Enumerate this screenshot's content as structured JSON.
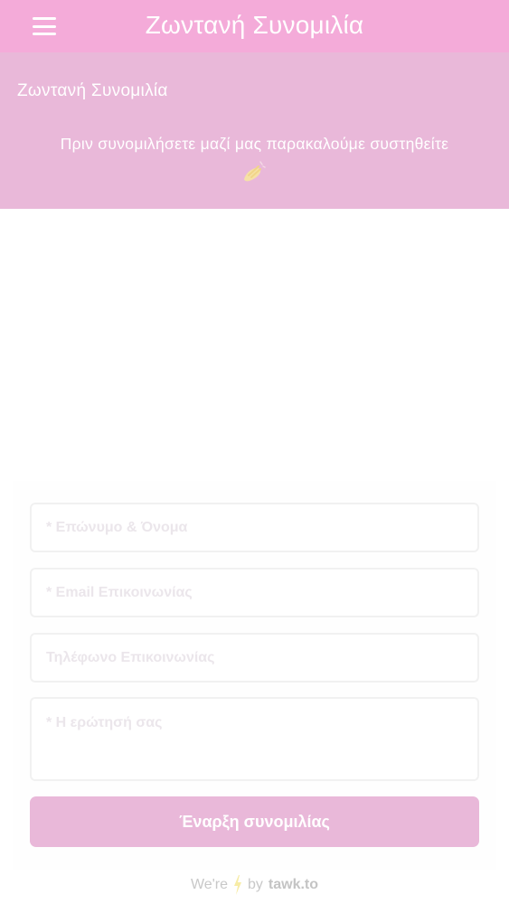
{
  "topbar": {
    "title": "Ζωντανή Συνομιλία",
    "menu_icon": "hamburger-menu-icon"
  },
  "chat_header": {
    "title": "Ζωντανή Συνομιλία",
    "message": "Πριν συνομιλήσετε μαζί μας παρακαλούμε συστηθείτε",
    "emoji_icon": "waving-hand-icon"
  },
  "form": {
    "name_placeholder": "* Επώνυμο & Όνομα",
    "email_placeholder": "* Email Επικοινωνίας",
    "phone_placeholder": "Τηλέφωνο Επικοινωνίας",
    "question_placeholder": "* Η ερώτησή σας",
    "submit_label": "Έναρξη συνομιλίας"
  },
  "footer": {
    "prefix": "We're",
    "by": "by",
    "brand": "tawk.to",
    "bolt_icon": "lightning-bolt-icon"
  },
  "colors": {
    "topbar": "#f4abd9",
    "header": "#e9b8d9",
    "button": "#e9b8d9"
  }
}
